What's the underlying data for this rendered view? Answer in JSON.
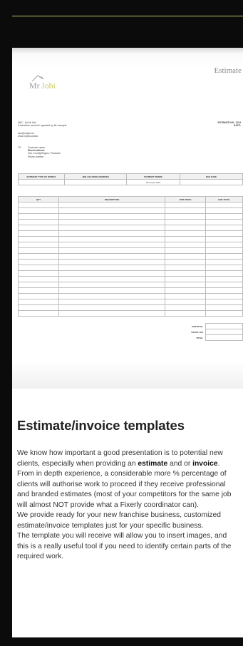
{
  "estimate_word": "Estimate",
  "logo": {
    "mr": "Mr",
    "jobi": "Jobi"
  },
  "company": {
    "line1": "ABC - t/a Mr Jobi",
    "line2": "A franchise owned & operated by Mr example",
    "email": "abc@mrjobi.uk",
    "web": "www.mrjobi.uk/abc"
  },
  "estimate_info": {
    "number": "ESTIMATE NO: 1234",
    "date": "DATE:"
  },
  "to": {
    "label": "TO",
    "name": "Customer name",
    "street": "Street address",
    "city": "City, County/Region, Postcode",
    "phone": "Phone number"
  },
  "info_table": {
    "headers": [
      "ESTIMATE TYPE OF WORKS",
      "JOB LOCATION ADDRESS",
      "PAYMENT TERMS",
      "DUE DATE"
    ],
    "row": [
      "",
      "",
      "Due upon start",
      ""
    ]
  },
  "items_table": {
    "headers": [
      "QTY",
      "DESCRIPTION",
      "UNIT PRICE",
      "LINE TOTAL"
    ]
  },
  "totals": [
    "SUBTOTAL",
    "SALES TAX",
    "TOTAL"
  ],
  "heading": "Estimate/invoice templates",
  "body": {
    "p1a": "We know how important a good presentation is to potential new clients, especially when providing an ",
    "estimate": "estimate",
    "p1b": " and or ",
    "invoice": "invoice",
    "p1c": ". From in depth experience, a considerable more % percentage of clients will authorise work to proceed if they receive professional and branded estimates (most of your competitors for the same job will almost NOT provide what a Fixerly coordinator can).",
    "p2": "We provide ready for your new franchise business, customized estimate/invoice templates just for your specific business.",
    "p3": "The template you will receive will allow you to insert images, and this is a really useful tool if you need to identify certain parts of the required work."
  }
}
